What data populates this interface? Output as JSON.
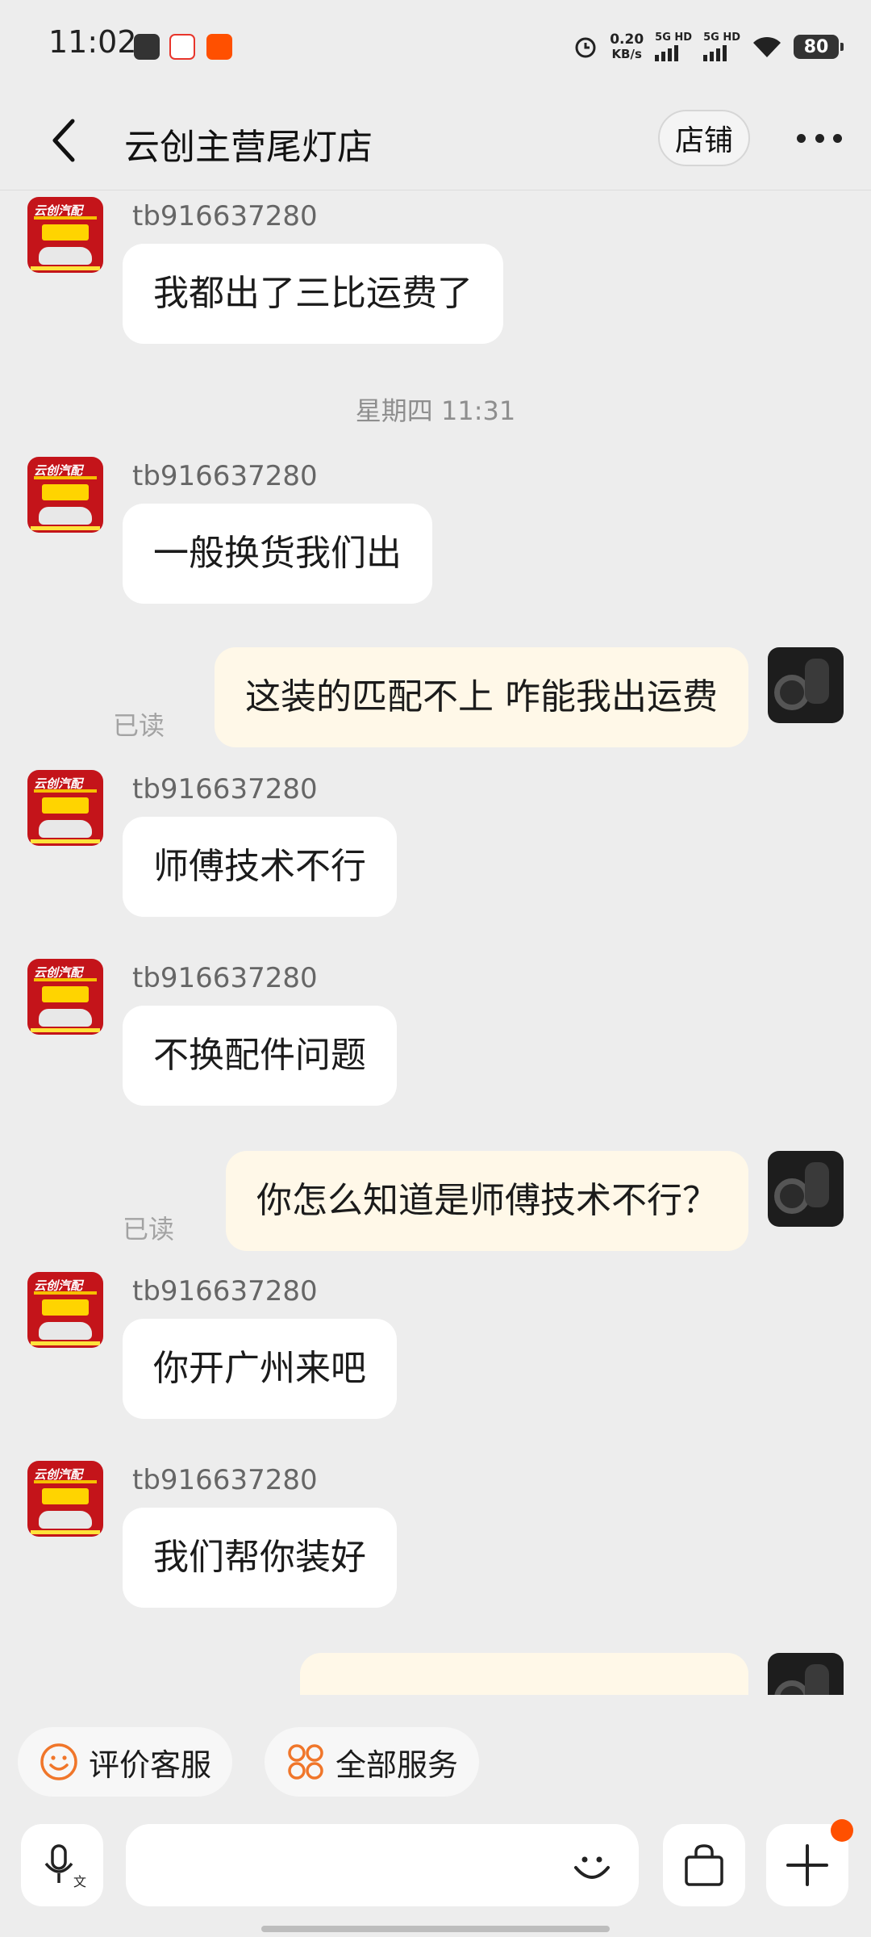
{
  "status_bar": {
    "time": "11:02",
    "net_speed_value": "0.20",
    "net_speed_unit": "KB/s",
    "net_type_1": "5G HD",
    "net_type_2": "5G HD",
    "battery": "80"
  },
  "header": {
    "title": "云创主营尾灯店",
    "shop_label": "店铺"
  },
  "messages": [
    {
      "side": "left",
      "sender": "tb916637280",
      "text": "我都出了三比运费了"
    },
    {
      "type": "timestamp",
      "text": "星期四 11:31"
    },
    {
      "side": "left",
      "sender": "tb916637280",
      "text": "一般换货我们出"
    },
    {
      "side": "right",
      "text": "这装的匹配不上 咋能我出运费",
      "status": "已读"
    },
    {
      "side": "left",
      "sender": "tb916637280",
      "text": "师傅技术不行"
    },
    {
      "side": "left",
      "sender": "tb916637280",
      "text": "不换配件问题"
    },
    {
      "side": "right",
      "text": "你怎么知道是师傅技术不行？",
      "status": "已读"
    },
    {
      "side": "left",
      "sender": "tb916637280",
      "text": "你开广州来吧"
    },
    {
      "side": "left",
      "sender": "tb916637280",
      "text": "我们帮你装好"
    }
  ],
  "shop_avatar_text": "云创汽配",
  "quick_actions": [
    {
      "label": "评价客服",
      "icon": "smiley-icon"
    },
    {
      "label": "全部服务",
      "icon": "grid-icon"
    }
  ],
  "colors": {
    "background": "#ededed",
    "bubble_left": "#ffffff",
    "bubble_right": "#fff8e8",
    "accent": "#ff5000",
    "icon_orange": "#f0762a"
  }
}
